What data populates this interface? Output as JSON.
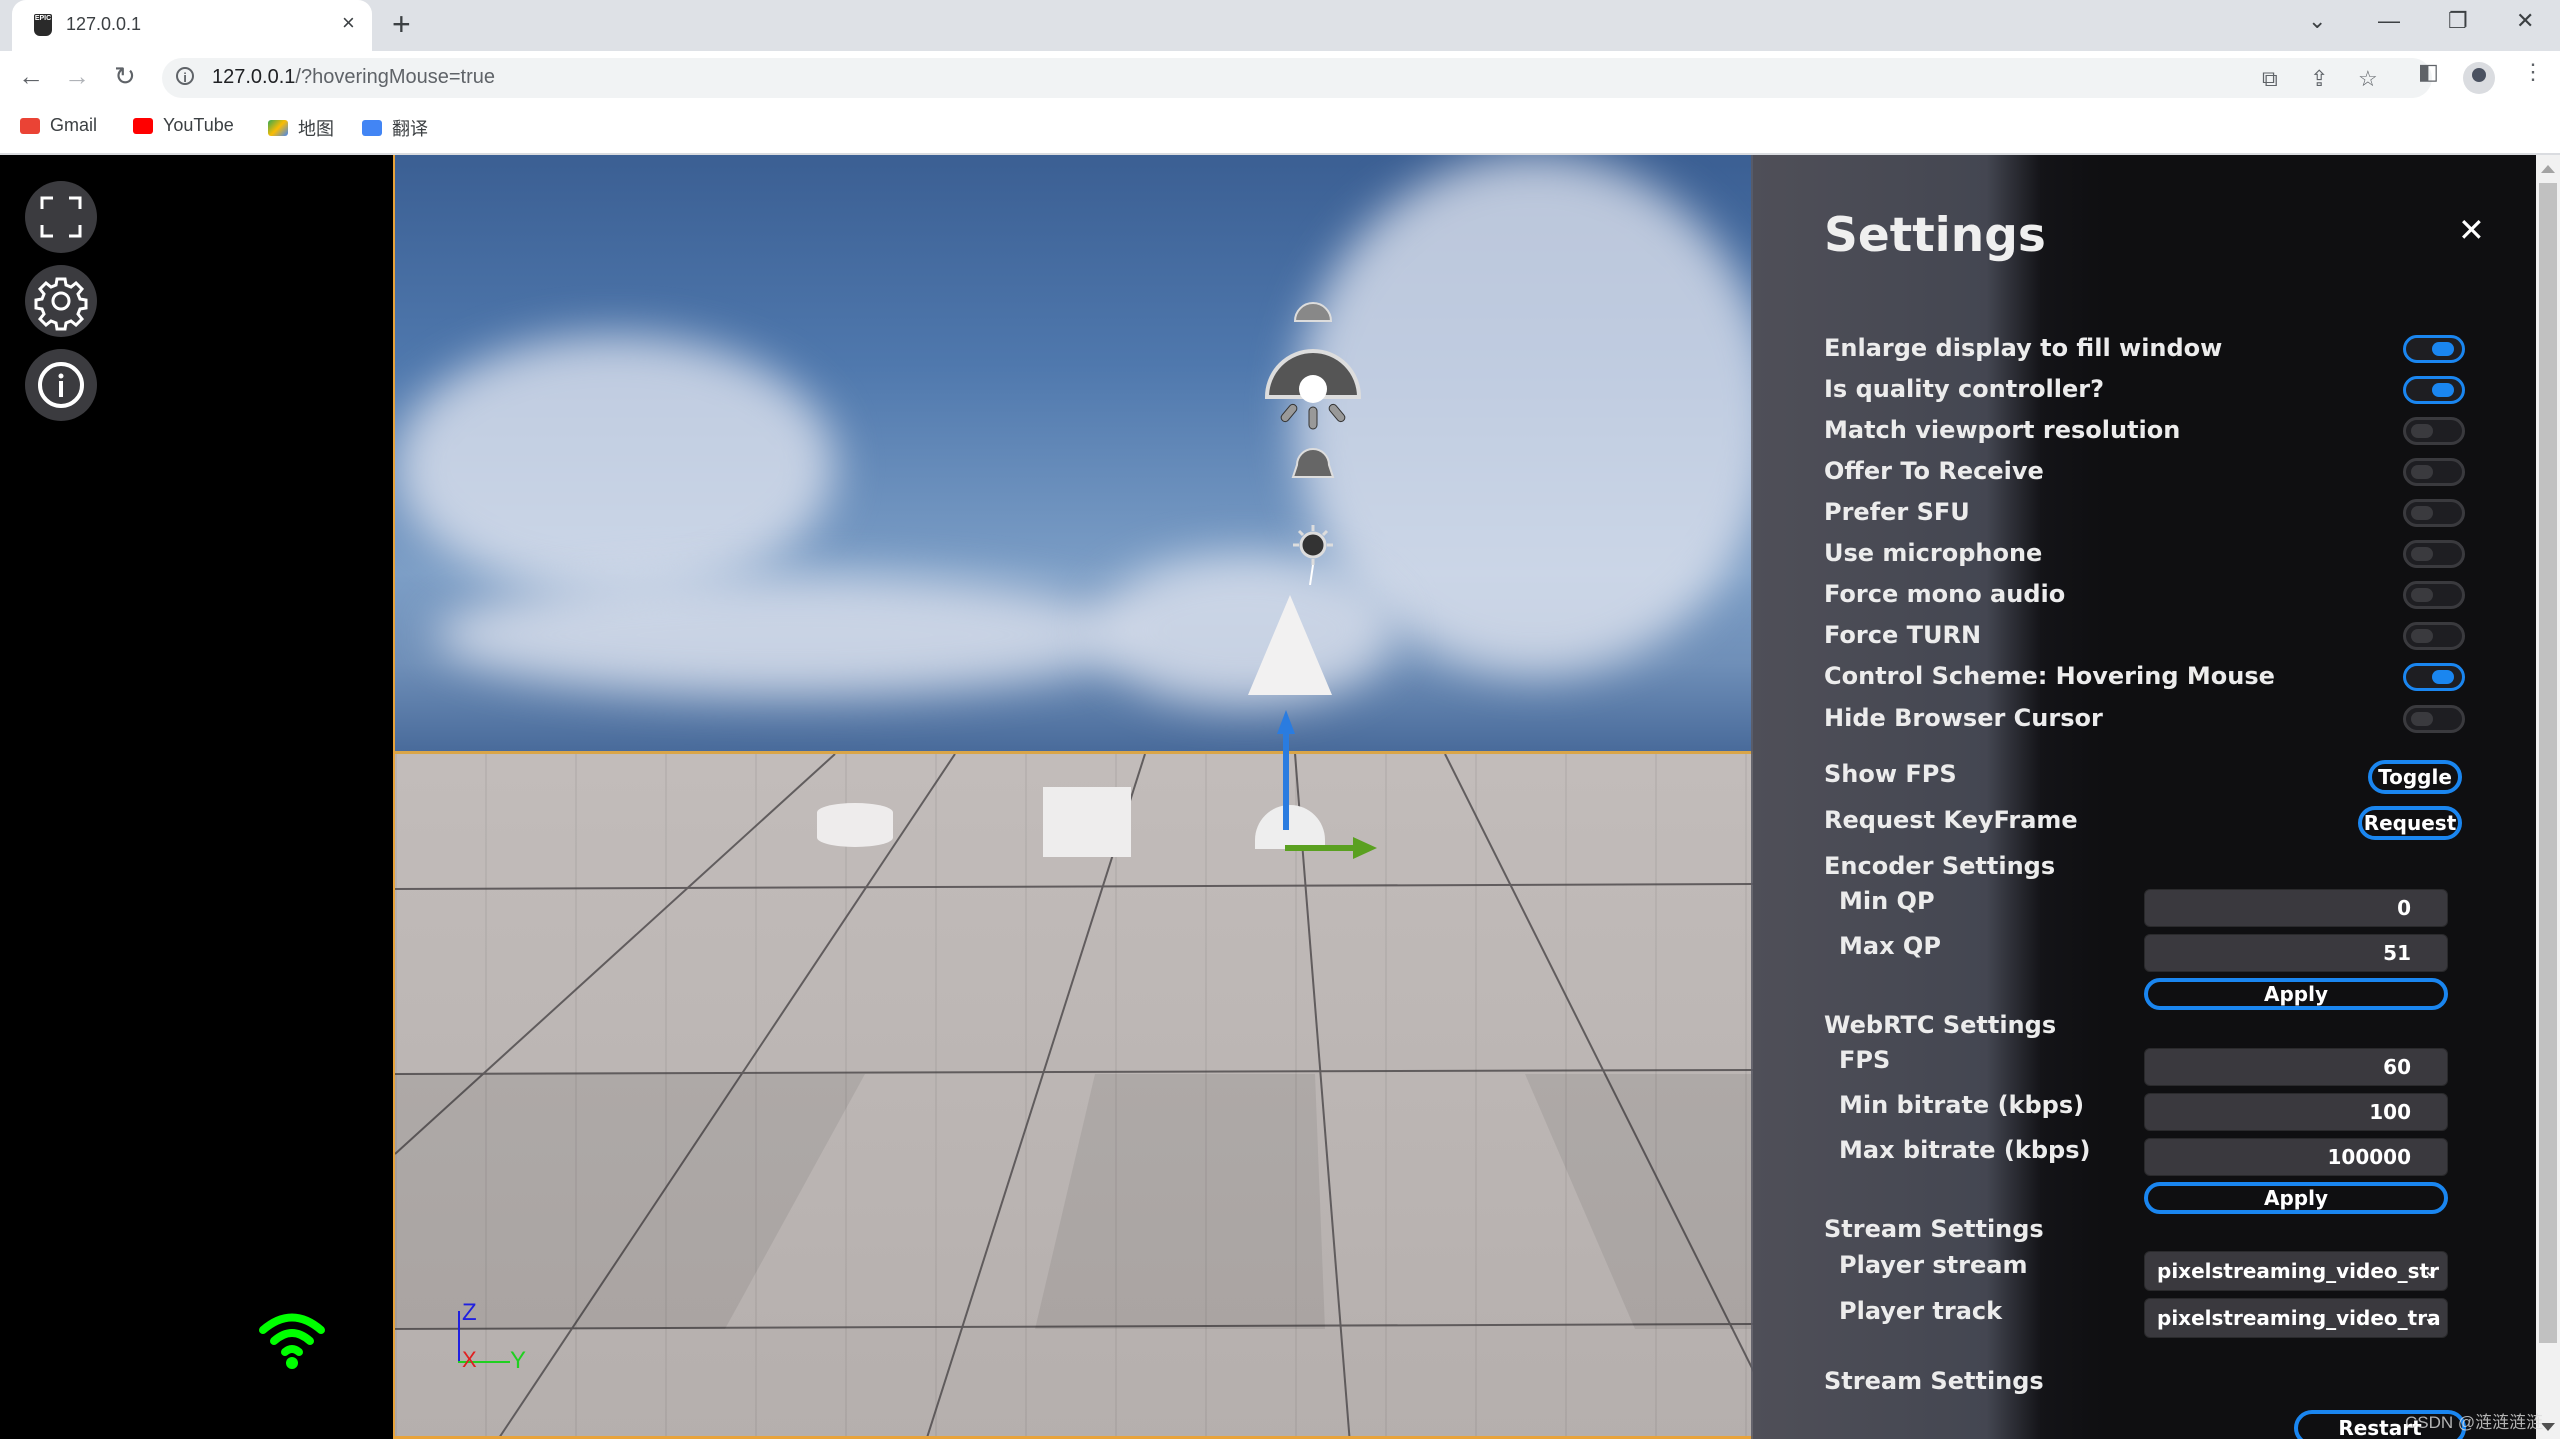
{
  "browser": {
    "tab": {
      "title": "127.0.0.1",
      "favicon": "epic-games-icon"
    },
    "new_tab_label": "+",
    "url_host": "127.0.0.1",
    "url_rest": "/?hoveringMouse=true",
    "bookmarks": [
      {
        "label": "Gmail",
        "icon": "gmail-icon",
        "color": "#ea4335"
      },
      {
        "label": "YouTube",
        "icon": "youtube-icon",
        "color": "#ff0000"
      },
      {
        "label": "地图",
        "icon": "maps-icon",
        "color": "#34a853"
      },
      {
        "label": "翻译",
        "icon": "translate-icon",
        "color": "#4285f4"
      }
    ]
  },
  "sidebar": {
    "buttons": [
      {
        "name": "fullscreen",
        "icon": "fullscreen-icon"
      },
      {
        "name": "settings",
        "icon": "gear-icon"
      },
      {
        "name": "info",
        "icon": "info-icon"
      }
    ],
    "connection_status": {
      "icon": "wifi-icon",
      "color": "#00ff00"
    }
  },
  "viewport": {
    "axis_labels": {
      "z": "Z",
      "x": "X",
      "y": "Y"
    },
    "colors": {
      "z": "#2020e0",
      "x": "#e02020",
      "y": "#20d020",
      "border": "#e8a33a"
    }
  },
  "settings": {
    "title": "Settings",
    "close_label": "✕",
    "toggles": [
      {
        "label": "Enlarge display to fill window",
        "on": true
      },
      {
        "label": "Is quality controller?",
        "on": true
      },
      {
        "label": "Match viewport resolution",
        "on": false
      },
      {
        "label": "Offer To Receive",
        "on": false
      },
      {
        "label": "Prefer SFU",
        "on": false
      },
      {
        "label": "Use microphone",
        "on": false
      },
      {
        "label": "Force mono audio",
        "on": false
      },
      {
        "label": "Force TURN",
        "on": false
      },
      {
        "label": "Control Scheme: Hovering Mouse",
        "on": true
      },
      {
        "label": "Hide Browser Cursor",
        "on": false
      }
    ],
    "show_fps": {
      "label": "Show FPS",
      "button": "Toggle"
    },
    "keyframe": {
      "label": "Request KeyFrame",
      "button": "Request"
    },
    "encoder": {
      "heading": "Encoder Settings",
      "min_qp": {
        "label": "Min QP",
        "value": "0"
      },
      "max_qp": {
        "label": "Max QP",
        "value": "51"
      },
      "apply": "Apply"
    },
    "webrtc": {
      "heading": "WebRTC Settings",
      "fps": {
        "label": "FPS",
        "value": "60"
      },
      "min_bitrate": {
        "label": "Min bitrate (kbps)",
        "value": "100"
      },
      "max_bitrate": {
        "label": "Max bitrate (kbps)",
        "value": "100000"
      },
      "apply": "Apply"
    },
    "stream": {
      "heading": "Stream Settings",
      "player_stream": {
        "label": "Player stream",
        "value": "pixelstreaming_video_str"
      },
      "player_track": {
        "label": "Player track",
        "value": "pixelstreaming_video_tra"
      }
    },
    "stream2": {
      "heading": "Stream Settings",
      "restart": "Restart stream"
    },
    "accent": "#1a86f0"
  },
  "watermark": "CSDN @涟涟涟涟"
}
